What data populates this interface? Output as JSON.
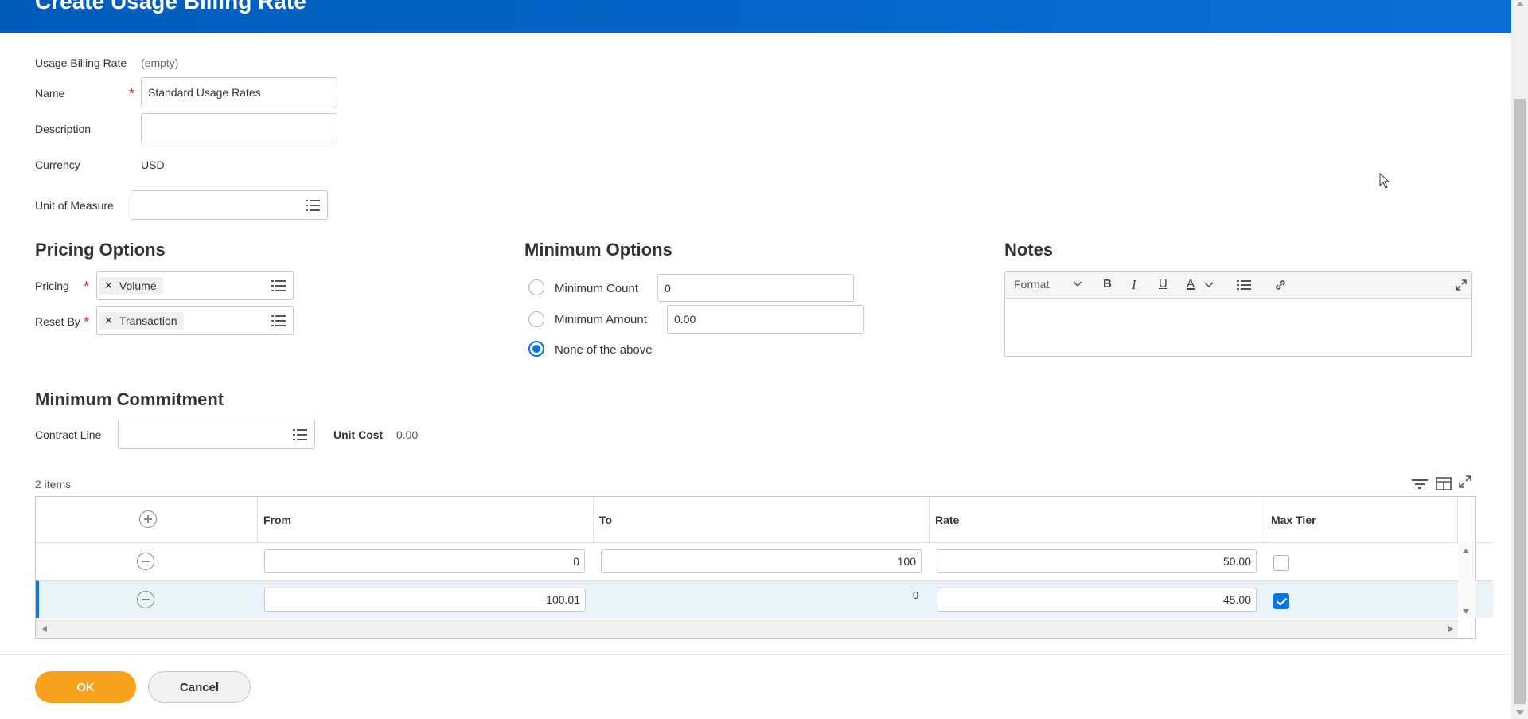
{
  "page": {
    "title": "Create Usage Billing Rate"
  },
  "form": {
    "usage_billing_rate": {
      "label": "Usage Billing Rate",
      "value": "(empty)"
    },
    "name": {
      "label": "Name",
      "value": "Standard Usage Rates",
      "required_mark": "*"
    },
    "description": {
      "label": "Description",
      "value": ""
    },
    "currency": {
      "label": "Currency",
      "value": "USD"
    },
    "unit_of_measure": {
      "label": "Unit of Measure",
      "value": ""
    }
  },
  "pricing_options": {
    "title": "Pricing Options",
    "pricing": {
      "label": "Pricing",
      "value": "Volume",
      "required_mark": "*"
    },
    "reset_by": {
      "label": "Reset By",
      "value": "Transaction",
      "required_mark": "*"
    }
  },
  "minimum_options": {
    "title": "Minimum Options",
    "minimum_count": {
      "label": "Minimum Count",
      "value": "0",
      "selected": false
    },
    "minimum_amount": {
      "label": "Minimum Amount",
      "value": "0.00",
      "selected": false
    },
    "none": {
      "label": "None of the above",
      "selected": true
    }
  },
  "notes": {
    "title": "Notes",
    "toolbar": {
      "format": "Format",
      "bold": "B",
      "italic": "I",
      "underline": "U",
      "color": "A"
    }
  },
  "minimum_commitment": {
    "title": "Minimum Commitment",
    "contract_line": {
      "label": "Contract Line",
      "value": ""
    },
    "unit_cost": {
      "label": "Unit Cost",
      "value": "0.00"
    }
  },
  "grid": {
    "count_label": "2 items",
    "columns": [
      "From",
      "To",
      "Rate",
      "Max Tier"
    ],
    "rows": [
      {
        "from": "0",
        "to": "100",
        "rate": "50.00",
        "max_tier": false
      },
      {
        "from": "100.01",
        "to": "0",
        "rate": "45.00",
        "max_tier": true
      }
    ]
  },
  "footer": {
    "ok": "OK",
    "cancel": "Cancel"
  },
  "colors": {
    "header": "#0a6fd6",
    "accent": "#0875e1",
    "ok_button": "#f6a21e",
    "required": "#de2e21"
  }
}
